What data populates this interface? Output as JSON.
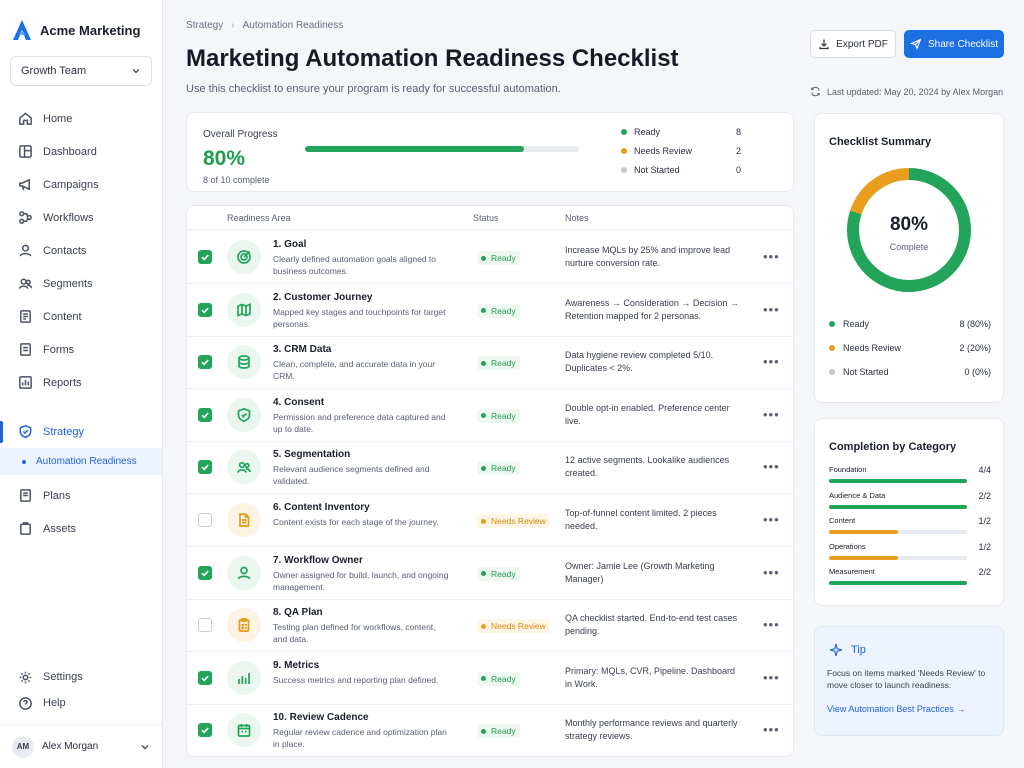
{
  "brand": {
    "name": "Acme Marketing",
    "logo_color": "#1d6fe4"
  },
  "team_select": {
    "value": "Growth Team"
  },
  "nav": {
    "items": [
      {
        "label": "Home",
        "icon": "home-icon"
      },
      {
        "label": "Dashboard",
        "icon": "dashboard-icon"
      },
      {
        "label": "Campaigns",
        "icon": "megaphone-icon"
      },
      {
        "label": "Workflows",
        "icon": "workflow-icon"
      },
      {
        "label": "Contacts",
        "icon": "contact-icon"
      },
      {
        "label": "Segments",
        "icon": "segments-icon"
      },
      {
        "label": "Content",
        "icon": "content-icon"
      },
      {
        "label": "Forms",
        "icon": "forms-icon"
      },
      {
        "label": "Reports",
        "icon": "reports-icon"
      }
    ],
    "strategy": {
      "label": "Strategy",
      "icon": "shield-icon"
    },
    "strategy_sub": {
      "label": "Automation Readiness"
    },
    "items_after": [
      {
        "label": "Plans",
        "icon": "plans-icon"
      },
      {
        "label": "Assets",
        "icon": "assets-icon"
      }
    ],
    "settings": "Settings",
    "help": "Help",
    "user": {
      "initials": "AM",
      "name": "Alex Morgan"
    }
  },
  "breadcrumb": {
    "parent": "Strategy",
    "sep": "›",
    "current": "Automation Readiness"
  },
  "page": {
    "title": "Marketing Automation Readiness Checklist",
    "subtitle": "Use this checklist to ensure your program is ready for successful automation."
  },
  "actions": {
    "export_label": "Export PDF",
    "share_label": "Share Checklist"
  },
  "last_updated": "Last updated: May 20, 2024 by Alex Morgan",
  "progress": {
    "label": "Overall Progress",
    "value": "80%",
    "fraction": 0.8,
    "sub": "8 of 10 complete",
    "legend": [
      {
        "label": "Ready",
        "count": "8",
        "color": "#22a55a"
      },
      {
        "label": "Needs Review",
        "count": "2",
        "color": "#e99d1f"
      },
      {
        "label": "Not Started",
        "count": "0",
        "color": "#c4c8d1"
      }
    ]
  },
  "table": {
    "headers": {
      "area": "Readiness Area",
      "status": "Status",
      "notes": "Notes"
    },
    "rows": [
      {
        "title": "1. Goal",
        "desc": "Clearly defined automation goals aligned to business outcomes.",
        "status": "Ready",
        "status_kind": "ready",
        "checked": true,
        "icon": "target-icon",
        "notes": "Increase MQLs by 25% and improve lead nurture conversion rate."
      },
      {
        "title": "2. Customer Journey",
        "desc": "Mapped key stages and touchpoints for target personas.",
        "status": "Ready",
        "status_kind": "ready",
        "checked": true,
        "icon": "map-icon",
        "notes": "Awareness → Consideration → Decision → Retention mapped for 2 personas."
      },
      {
        "title": "3. CRM Data",
        "desc": "Clean, complete, and accurate data in your CRM.",
        "status": "Ready",
        "status_kind": "ready",
        "checked": true,
        "icon": "database-icon",
        "notes": "Data hygiene review completed 5/10. Duplicates < 2%."
      },
      {
        "title": "4. Consent",
        "desc": "Permission and preference data captured and up to date.",
        "status": "Ready",
        "status_kind": "ready",
        "checked": true,
        "icon": "shield-check-icon",
        "notes": "Double opt-in enabled. Preference center live."
      },
      {
        "title": "5. Segmentation",
        "desc": "Relevant audience segments defined and validated.",
        "status": "Ready",
        "status_kind": "ready",
        "checked": true,
        "icon": "users-icon",
        "notes": "12 active segments. Lookalike audiences created."
      },
      {
        "title": "6. Content Inventory",
        "desc": "Content exists for each stage of the journey.",
        "status": "Needs Review",
        "status_kind": "review",
        "checked": false,
        "icon": "document-icon",
        "notes": "Top-of-funnel content limited. 2 pieces needed."
      },
      {
        "title": "7. Workflow Owner",
        "desc": "Owner assigned for build, launch, and ongoing management.",
        "status": "Ready",
        "status_kind": "ready",
        "checked": true,
        "icon": "user-icon",
        "notes": "Owner: Jamie Lee (Growth Marketing Manager)"
      },
      {
        "title": "8. QA Plan",
        "desc": "Testing plan defined for workflows, content, and data.",
        "status": "Needs Review",
        "status_kind": "review",
        "checked": false,
        "icon": "clipboard-icon",
        "notes": "QA checklist started. End-to-end test cases pending."
      },
      {
        "title": "9. Metrics",
        "desc": "Success metrics and reporting plan defined.",
        "status": "Ready",
        "status_kind": "ready",
        "checked": true,
        "icon": "bar-chart-icon",
        "notes": "Primary: MQLs, CVR, Pipeline. Dashboard in Work."
      },
      {
        "title": "10. Review Cadence",
        "desc": "Regular review cadence and optimization plan in place.",
        "status": "Ready",
        "status_kind": "ready",
        "checked": true,
        "icon": "calendar-icon",
        "notes": "Monthly performance reviews and quarterly strategy reviews."
      }
    ]
  },
  "summary": {
    "title": "Checklist Summary",
    "value": "80%",
    "label": "Complete",
    "fractions": {
      "ready": 0.8,
      "review": 0.2,
      "not_started": 0
    },
    "rows": [
      {
        "label": "Ready",
        "value": "8 (80%)",
        "color": "#22a55a"
      },
      {
        "label": "Needs Review",
        "value": "2 (20%)",
        "color": "#e99d1f"
      },
      {
        "label": "Not Started",
        "value": "0 (0%)",
        "color": "#c4c8d1"
      }
    ]
  },
  "categories": {
    "title": "Completion by Category",
    "items": [
      {
        "name": "Foundation",
        "value": "4/4",
        "fraction": 1.0,
        "color": "#22a55a"
      },
      {
        "name": "Audience & Data",
        "value": "2/2",
        "fraction": 1.0,
        "color": "#22a55a"
      },
      {
        "name": "Content",
        "value": "1/2",
        "fraction": 0.5,
        "color": "#e99d1f"
      },
      {
        "name": "Operations",
        "value": "1/2",
        "fraction": 0.5,
        "color": "#e99d1f"
      },
      {
        "name": "Measurement",
        "value": "2/2",
        "fraction": 1.0,
        "color": "#22a55a"
      }
    ]
  },
  "tip": {
    "title": "Tip",
    "text": "Focus on items marked 'Needs Review' to move closer to launch readiness.",
    "link": "View Automation Best Practices →"
  }
}
